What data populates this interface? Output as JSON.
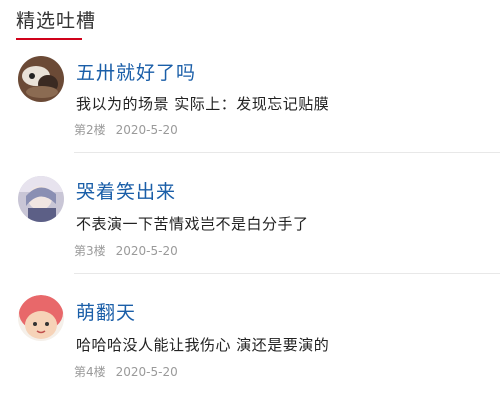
{
  "header": {
    "title": "精选吐槽"
  },
  "comments": [
    {
      "username": "五卅就好了吗",
      "content": "我以为的场景 实际上：发现忘记贴膜",
      "floor": "第2楼",
      "date": "2020-5-20"
    },
    {
      "username": "哭着笑出来",
      "content": "不表演一下苦情戏岂不是白分手了",
      "floor": "第3楼",
      "date": "2020-5-20"
    },
    {
      "username": "萌翻天",
      "content": "哈哈哈没人能让我伤心 演还是要演的",
      "floor": "第4楼",
      "date": "2020-5-20"
    }
  ],
  "colors": {
    "accent": "#d0021b",
    "username": "#1a5ea8",
    "meta": "#9a9a9a"
  }
}
